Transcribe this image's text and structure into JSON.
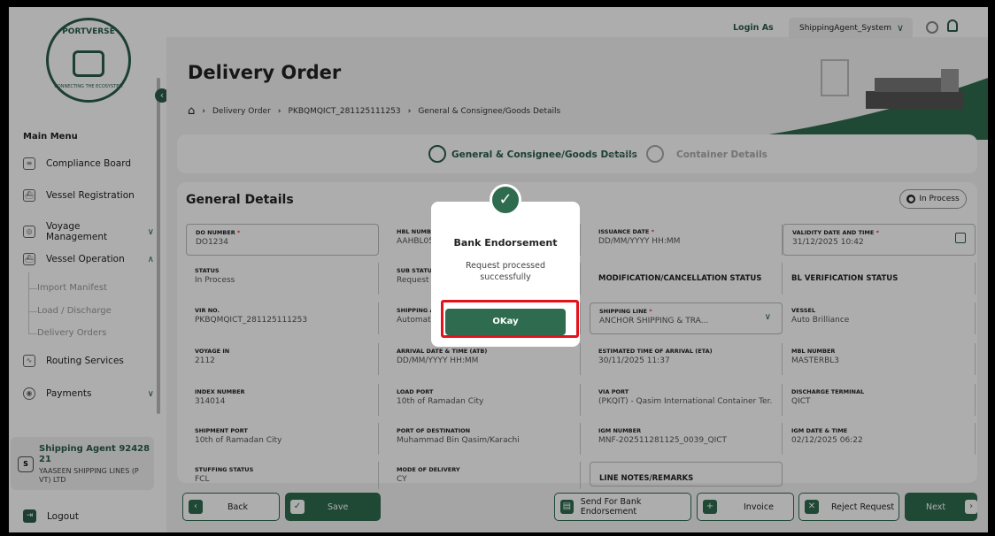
{
  "logo": {
    "brand": "PORTVERSE",
    "tagline": "CONNECTING THE ECOSYSTEM"
  },
  "top": {
    "login_as": "Login As",
    "role": "ShippingAgent_System"
  },
  "page": {
    "title": "Delivery Order"
  },
  "breadcrumb": {
    "items": [
      "Delivery Order",
      "PKBQMQICT_281125111253",
      "General & Consignee/Goods Details"
    ]
  },
  "stepper": {
    "step1": "General & Consignee/Goods Details",
    "step2": "Container Details"
  },
  "sidebar": {
    "main_menu": "Main Menu",
    "items": [
      {
        "label": "Compliance Board"
      },
      {
        "label": "Vessel Registration"
      },
      {
        "label": "Voyage Management"
      },
      {
        "label": "Vessel Operation"
      },
      {
        "label": "Routing Services"
      },
      {
        "label": "Payments"
      }
    ],
    "sub_items": [
      "Import Manifest",
      "Load / Discharge",
      "Delivery Orders"
    ],
    "agent": {
      "initial": "S",
      "name": "Shipping Agent 92428 21",
      "company": "YAASEEN SHIPPING LINES (P VT) LTD"
    },
    "logout": "Logout"
  },
  "form": {
    "section_title": "General Details",
    "status_badge": "In Process",
    "fields": {
      "do_number": {
        "label": "DO NUMBER",
        "value": "DO1234"
      },
      "hbl_number": {
        "label": "HBL NUMBER",
        "value": "AAHBL05"
      },
      "issuance_date": {
        "label": "ISSUANCE DATE",
        "value": "DD/MM/YYYY HH:MM"
      },
      "validity": {
        "label": "VALIDITY DATE AND TIME",
        "value": "31/12/2025 10:42"
      },
      "status": {
        "label": "STATUS",
        "value": "In Process"
      },
      "sub_status": {
        "label": "SUB STATUS",
        "value": "Request S"
      },
      "mod_status": {
        "label": "MODIFICATION/CANCELLATION STATUS"
      },
      "bl_status": {
        "label": "BL VERIFICATION STATUS"
      },
      "vir_no": {
        "label": "VIR NO.",
        "value": "PKBQMQICT_281125111253"
      },
      "shipping_agent": {
        "label": "SHIPPING AG",
        "value": "Automatio"
      },
      "shipping_line": {
        "label": "SHIPPING LINE",
        "value": "ANCHOR SHIPPING & TRA..."
      },
      "vessel": {
        "label": "VESSEL",
        "value": "Auto Brilliance"
      },
      "voyage_in": {
        "label": "VOYAGE IN",
        "value": "2112"
      },
      "atb": {
        "label": "ARRIVAL DATE & TIME (ATB)",
        "value": "DD/MM/YYYY HH:MM"
      },
      "eta": {
        "label": "ESTIMATED TIME OF ARRIVAL (ETA)",
        "value": "30/11/2025 11:37"
      },
      "mbl": {
        "label": "MBL NUMBER",
        "value": "MASTERBL3"
      },
      "index_no": {
        "label": "INDEX NUMBER",
        "value": "314014"
      },
      "load_port": {
        "label": "LOAD PORT",
        "value": "10th of Ramadan City"
      },
      "via_port": {
        "label": "VIA PORT",
        "value": "(PKQIT) - Qasim International Container Ter..."
      },
      "discharge_terminal": {
        "label": "DISCHARGE TERMINAL",
        "value": "QICT"
      },
      "shipment_port": {
        "label": "SHIPMENT PORT",
        "value": "10th of Ramadan City"
      },
      "dest_port": {
        "label": "PORT OF DESTINATION",
        "value": "Muhammad Bin Qasim/Karachi"
      },
      "igm_number": {
        "label": "IGM NUMBER",
        "value": "MNF-202511281125_0039_QICT"
      },
      "igm_date": {
        "label": "IGM DATE & TIME",
        "value": "02/12/2025 06:22"
      },
      "stuffing": {
        "label": "STUFFING STATUS",
        "value": "FCL"
      },
      "delivery_mode": {
        "label": "MODE OF DELIVERY",
        "value": "CY"
      },
      "line_notes": {
        "label": "LINE NOTES/REMARKS"
      }
    }
  },
  "bottom": {
    "back": "Back",
    "save": "Save",
    "send_endorsement": "Send For Bank Endorsement",
    "invoice": "Invoice",
    "reject": "Reject Request",
    "next": "Next"
  },
  "modal": {
    "title": "Bank Endorsement",
    "message": "Request processed successfully",
    "ok": "OKay"
  },
  "colors": {
    "primary": "#2f6b4f",
    "highlight": "#e3131b"
  }
}
